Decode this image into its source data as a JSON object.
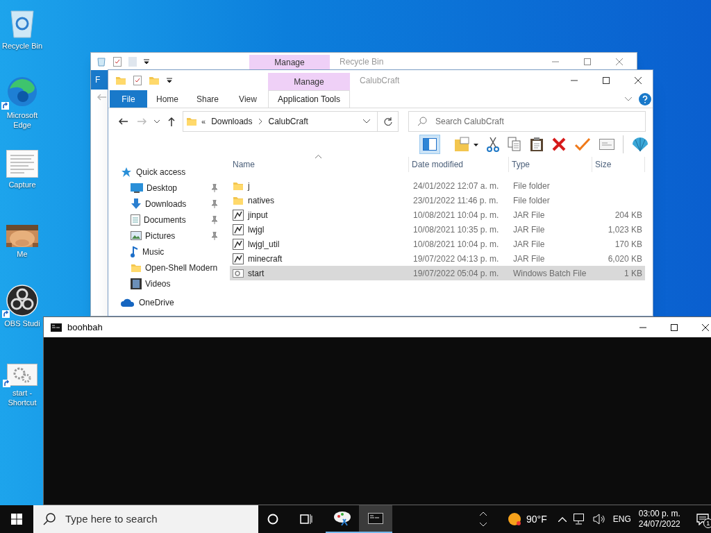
{
  "desktop_icons": [
    {
      "label": "Recycle Bin",
      "kind": "recycle",
      "shortcut": false
    },
    {
      "label": "Microsoft Edge",
      "kind": "browser",
      "shortcut": true
    },
    {
      "label": "Capture",
      "kind": "document",
      "shortcut": false
    },
    {
      "label": "Me",
      "kind": "picture",
      "shortcut": false
    },
    {
      "label": "OBS Studi",
      "kind": "obs",
      "shortcut": true
    },
    {
      "label": "start - Shortcut",
      "kind": "gears",
      "shortcut": true
    }
  ],
  "back_window": {
    "title": "Recycle Bin",
    "context_tab": "Manage",
    "file_tab": "F"
  },
  "window": {
    "title": "CalubCraft",
    "context_tab": "Manage",
    "ribbon_tabs": [
      {
        "label": "File",
        "kind": "file"
      },
      {
        "label": "Home",
        "kind": "plain"
      },
      {
        "label": "Share",
        "kind": "plain"
      },
      {
        "label": "View",
        "kind": "plain"
      },
      {
        "label": "Application Tools",
        "kind": "context"
      }
    ],
    "address": {
      "overflow": "«",
      "path": [
        "Downloads",
        "CalubCraft"
      ]
    },
    "search": {
      "placeholder": "Search CalubCraft"
    },
    "nav": [
      {
        "label": "Quick access",
        "kind": "star",
        "children": [
          {
            "label": "Desktop",
            "kind": "desktop",
            "pinned": true
          },
          {
            "label": "Downloads",
            "kind": "download",
            "pinned": true
          },
          {
            "label": "Documents",
            "kind": "documents",
            "pinned": true
          },
          {
            "label": "Pictures",
            "kind": "pictures",
            "pinned": true
          },
          {
            "label": "Music",
            "kind": "music",
            "pinned": false
          },
          {
            "label": "Open-Shell Modern",
            "kind": "folder",
            "pinned": false
          },
          {
            "label": "Videos",
            "kind": "videos",
            "pinned": false
          }
        ]
      },
      {
        "label": "OneDrive",
        "kind": "cloud"
      }
    ],
    "columns": [
      "Name",
      "Date modified",
      "Type",
      "Size"
    ],
    "files": [
      {
        "name": "j",
        "date": "24/01/2022 12:07 a. m.",
        "type": "File folder",
        "kind": "folder",
        "selected": false
      },
      {
        "name": "natives",
        "date": "23/01/2022 11:46 p. m.",
        "type": "File folder",
        "kind": "folder",
        "selected": false
      },
      {
        "name": "jinput",
        "date": "10/08/2021 10:04 p. m.",
        "type": "JAR File",
        "size": "204 KB",
        "kind": "jar",
        "selected": false
      },
      {
        "name": "lwjgl",
        "date": "10/08/2021 10:35 p. m.",
        "type": "JAR File",
        "size": "1,023 KB",
        "kind": "jar",
        "selected": false
      },
      {
        "name": "lwjgl_util",
        "date": "10/08/2021 10:04 p. m.",
        "type": "JAR File",
        "size": "170 KB",
        "kind": "jar",
        "selected": false
      },
      {
        "name": "minecraft",
        "date": "19/07/2022 04:13 p. m.",
        "type": "JAR File",
        "size": "6,020 KB",
        "kind": "jar",
        "selected": false
      },
      {
        "name": "start",
        "date": "19/07/2022 05:04 p. m.",
        "type": "Windows Batch File",
        "size": "1 KB",
        "kind": "batch",
        "selected": true
      }
    ]
  },
  "console": {
    "title": "boohbah"
  },
  "taskbar": {
    "search": {
      "placeholder": "Type here to search"
    },
    "apps": [
      {
        "kind": "paint",
        "active": false
      },
      {
        "kind": "console",
        "active": true
      }
    ],
    "weather": "90°F",
    "language": "ENG",
    "time": "03:00 p. m.",
    "date": "24/07/2022",
    "notifications": "1"
  }
}
